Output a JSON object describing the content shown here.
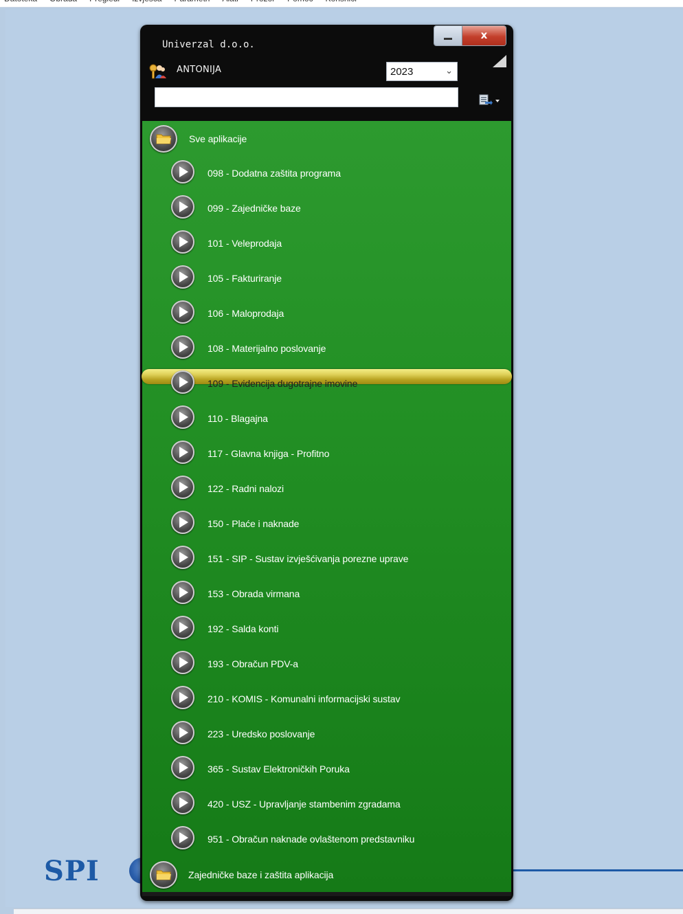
{
  "menubar": [
    "Datoteka",
    "Obrada",
    "Pregledi",
    "Izvješća",
    "Parametri",
    "Alati",
    "Prozor",
    "Pomoć",
    "Korisnici"
  ],
  "launcher": {
    "company": "Univerzal d.o.o.",
    "close_glyph": "x",
    "user": "ANTONIJA",
    "year": "2023",
    "search_placeholder": "",
    "icons": {
      "user": "users-key-icon",
      "minimize": "minimize-icon",
      "close": "close-icon",
      "corner": "corner-fold-icon",
      "tool": "export-dropdown-icon",
      "category": "folder-icon",
      "item": "play-icon"
    },
    "category_top": "Sve aplikacije",
    "items": [
      "098 - Dodatna zaštita programa",
      "099 - Zajedničke baze",
      "101 - Veleprodaja",
      "105 - Fakturiranje",
      "106 - Maloprodaja",
      "108 - Materijalno poslovanje",
      "109 - Evidencija dugotrajne imovine",
      "110 - Blagajna",
      "117 - Glavna knjiga - Profitno",
      "122 - Radni nalozi",
      "150 - Plaće i naknade",
      "151 - SIP - Sustav izvješćivanja porezne uprave",
      "153 - Obrada virmana",
      "192 - Salda konti",
      "193 - Obračun PDV-a",
      "210 - KOMIS - Komunalni informacijski sustav",
      "223 - Uredsko poslovanje",
      "365 - Sustav Elektroničkih Poruka",
      "420 - USZ - Upravljanje stambenim zgradama",
      "951 - Obračun naknade ovlaštenom predstavniku"
    ],
    "selected_index": 6,
    "category_bottom": "Zajedničke baze i zaštita aplikacija"
  },
  "background": {
    "logo_text": "SPI"
  },
  "colors": {
    "list_green": "#228f24",
    "highlight_yellow": "#e0d25a",
    "workspace_blue": "#b9cfe6"
  }
}
